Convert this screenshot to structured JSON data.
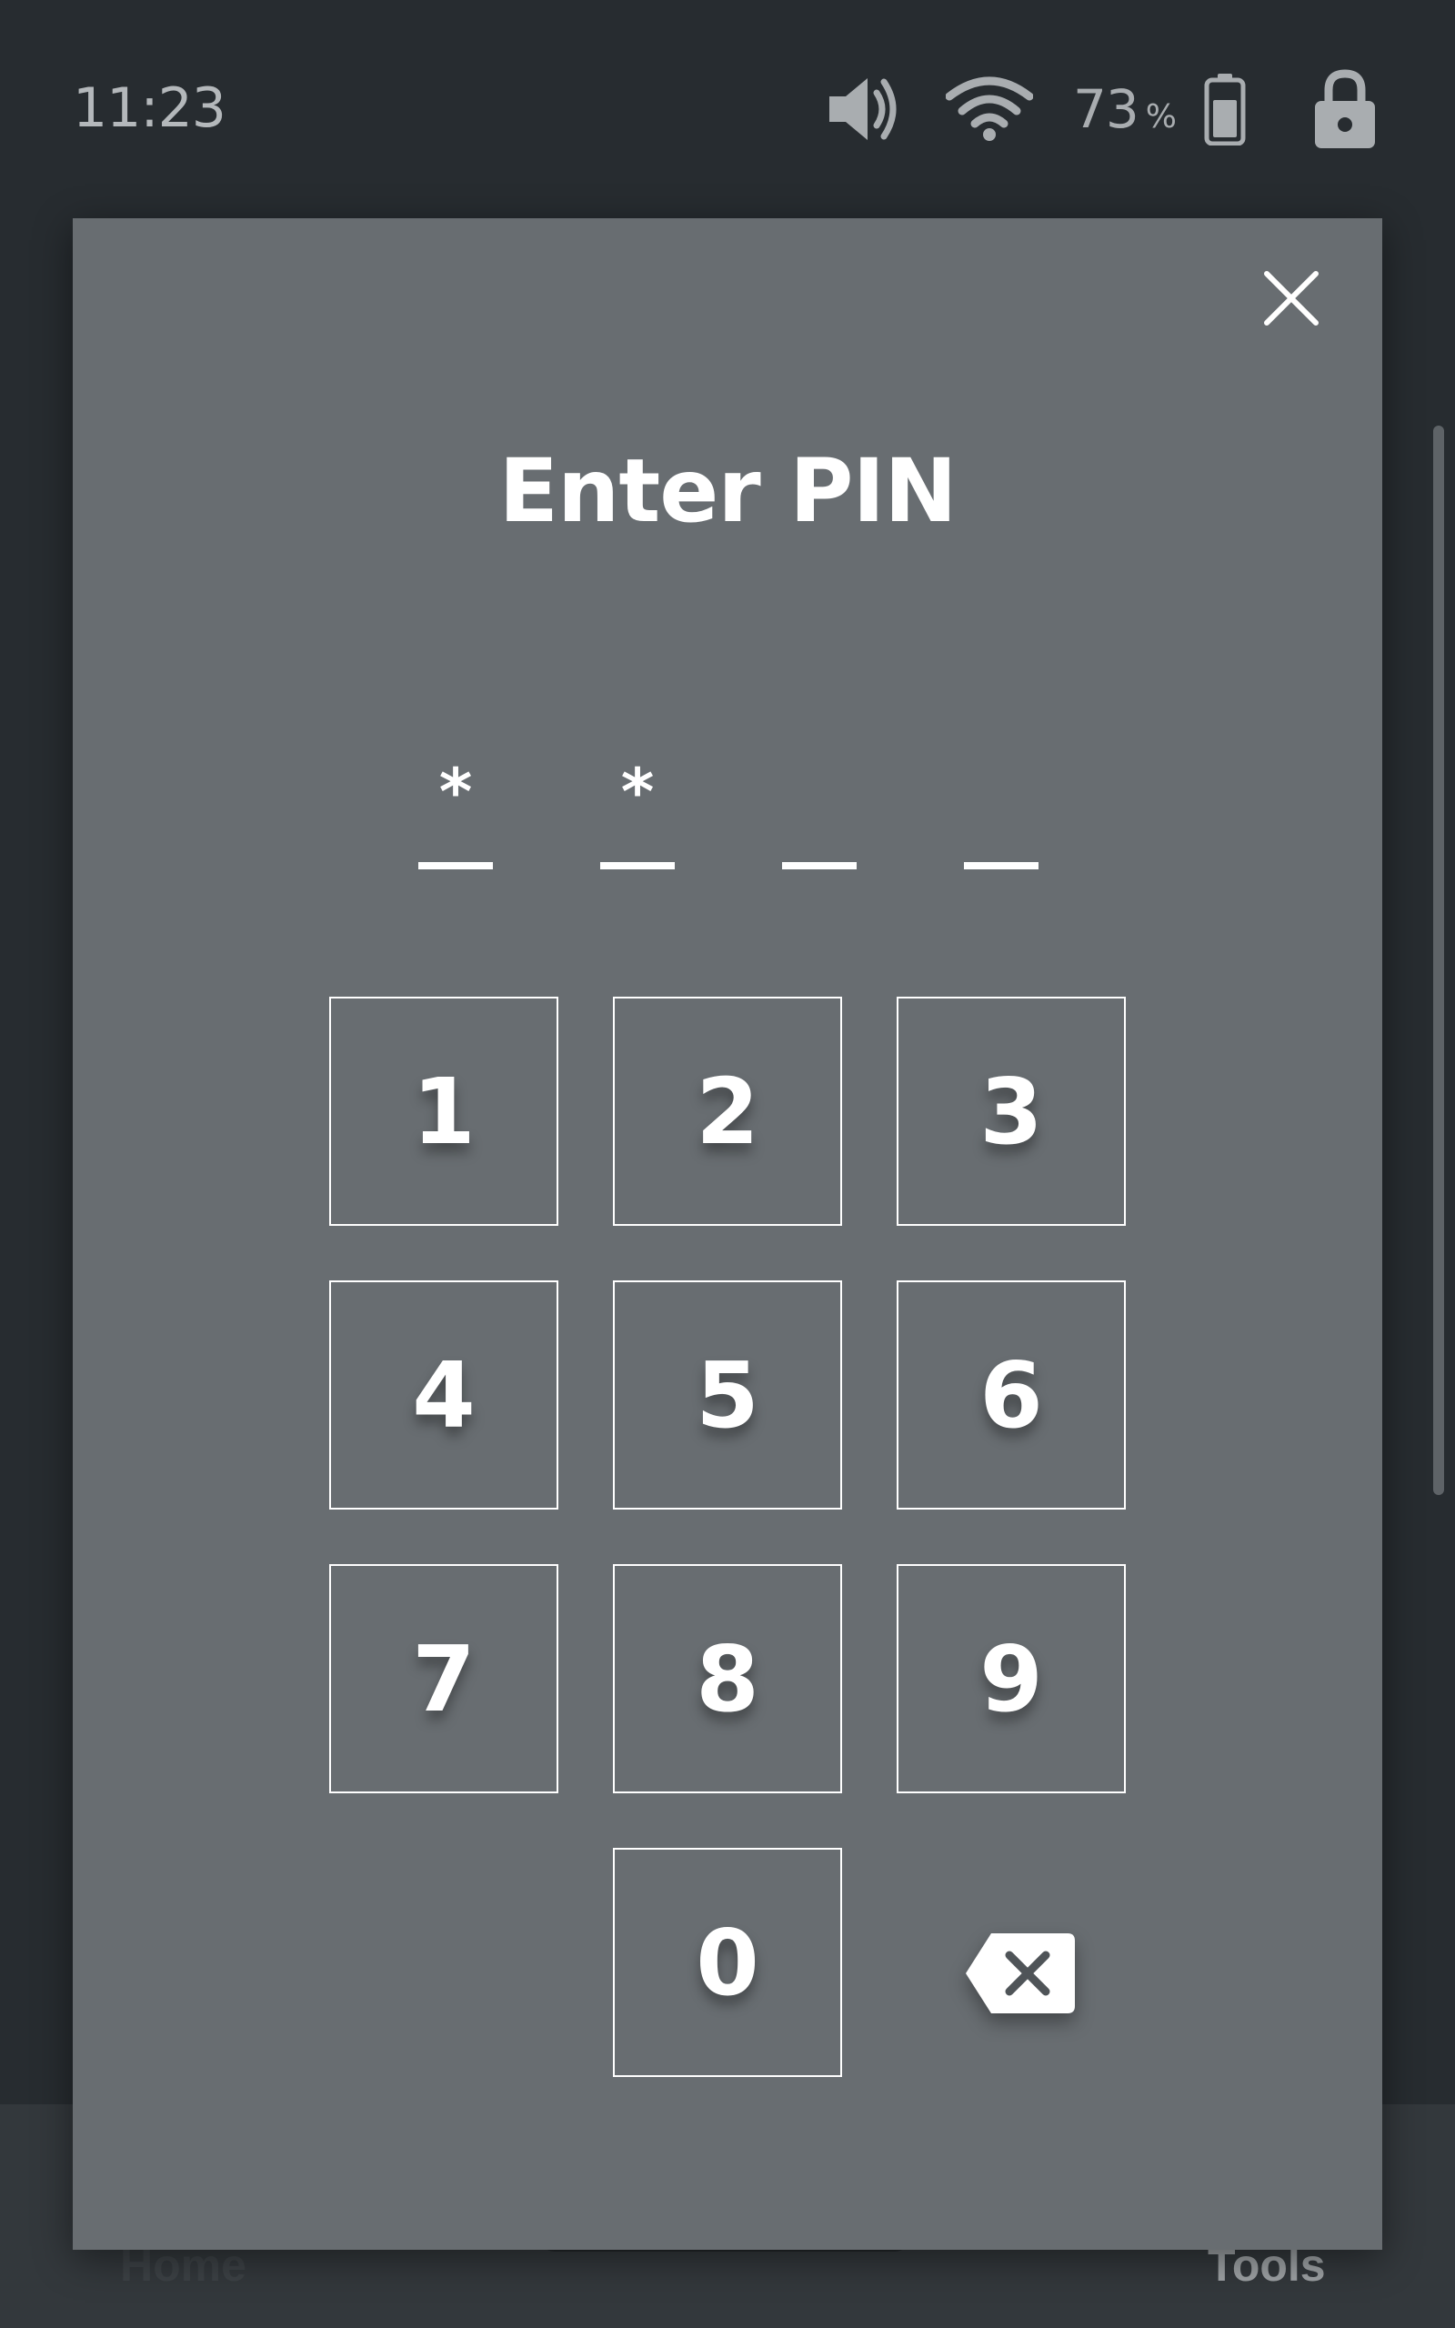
{
  "status_bar": {
    "time": "11:23",
    "battery_level": "73",
    "battery_unit": "%",
    "icons": [
      "volume-icon",
      "wifi-icon",
      "battery-icon",
      "lock-icon"
    ]
  },
  "background_nav": {
    "home_label": "Home",
    "tools_label": "Tools"
  },
  "dialog": {
    "title": "Enter PIN",
    "close_icon": "close-icon",
    "pin": {
      "length": 4,
      "entered": [
        "*",
        "*",
        "",
        ""
      ]
    },
    "keys": [
      "1",
      "2",
      "3",
      "4",
      "5",
      "6",
      "7",
      "8",
      "9",
      "0"
    ],
    "backspace_icon": "backspace-icon"
  },
  "colors": {
    "status_bar_bg": "#272c30",
    "dialog_bg": "#686d71",
    "foreground": "#ffffff"
  }
}
